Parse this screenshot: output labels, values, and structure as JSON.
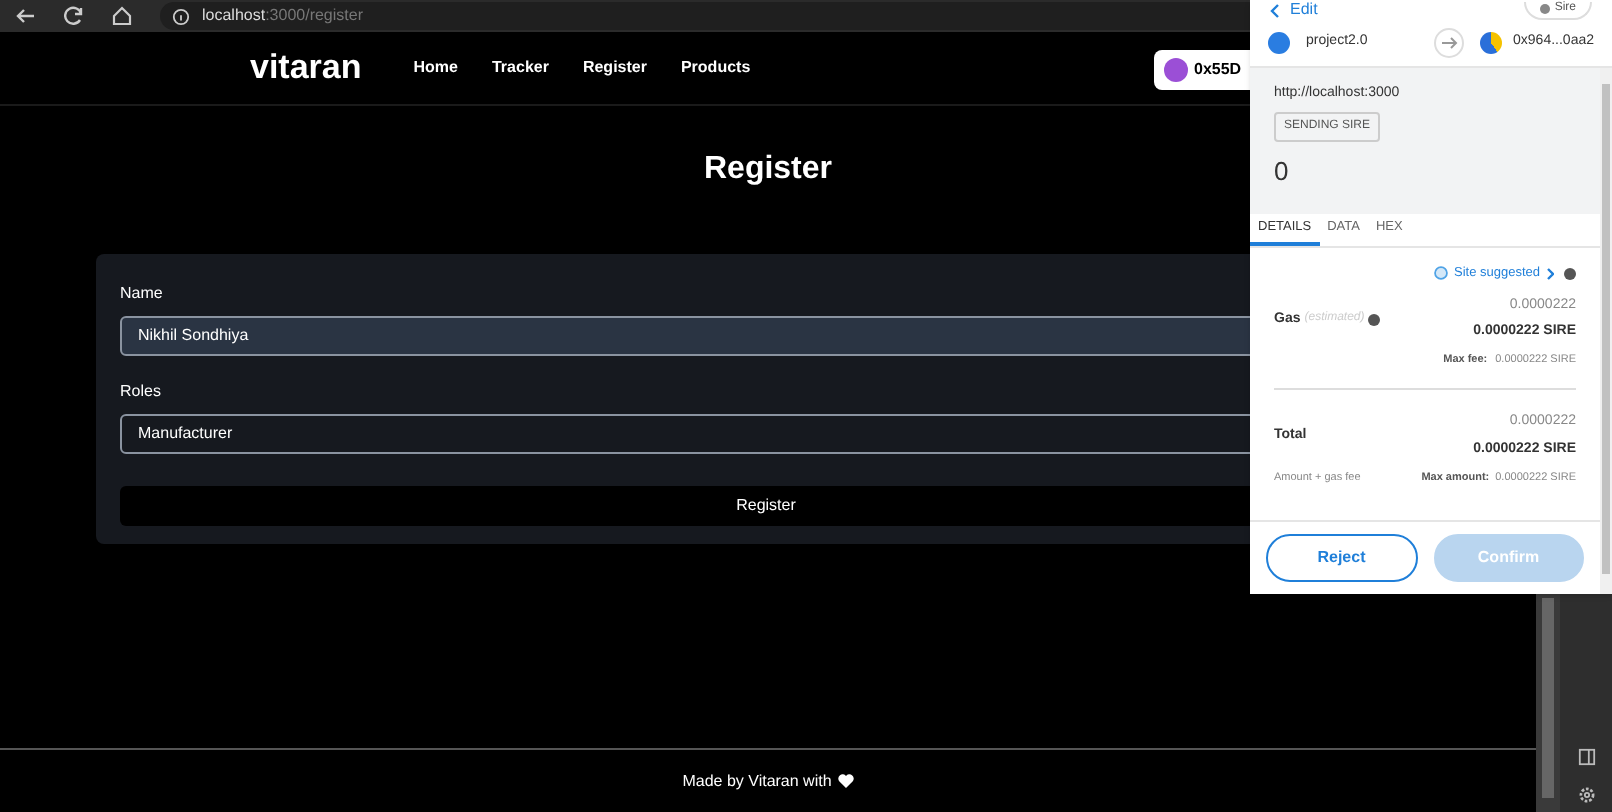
{
  "browser": {
    "url_host": "localhost",
    "url_path": ":3000/register"
  },
  "nav": {
    "brand": "vitaran",
    "links": [
      {
        "label": "Home"
      },
      {
        "label": "Tracker"
      },
      {
        "label": "Register"
      },
      {
        "label": "Products"
      }
    ],
    "wallet": "0x55D"
  },
  "page": {
    "title": "Register",
    "fields": [
      {
        "kind": "text",
        "label": "Name",
        "value": "Nikhil Sondhiya"
      },
      {
        "kind": "select",
        "label": "Roles",
        "value": "Manufacturer"
      }
    ],
    "submit": "Register"
  },
  "footer": {
    "text": "Made by Vitaran with"
  },
  "wallet_popup": {
    "back": "Edit",
    "network": "Sire",
    "from": "project2.0",
    "to": "0x964...0aa2",
    "origin": "http://localhost:3000",
    "badge": "SENDING SIRE",
    "amount": "0",
    "tabs": [
      {
        "label": "DETAILS",
        "selected": true
      },
      {
        "label": "DATA",
        "selected": false
      },
      {
        "label": "HEX",
        "selected": false
      }
    ],
    "site_suggested": "Site suggested",
    "gas": {
      "label": "Gas",
      "note": "(estimated)",
      "fiat": "0.0000222",
      "amount": "0.0000222 SIRE",
      "max_label": "Max fee:",
      "max_value": "0.0000222 SIRE"
    },
    "total": {
      "label": "Total",
      "fiat": "0.0000222",
      "amount": "0.0000222 SIRE",
      "note": "Amount + gas fee",
      "max_label": "Max amount:",
      "max_value": "0.0000222 SIRE"
    },
    "buttons": [
      {
        "label": "Reject",
        "disabled": false
      },
      {
        "label": "Confirm",
        "disabled": true
      }
    ]
  }
}
